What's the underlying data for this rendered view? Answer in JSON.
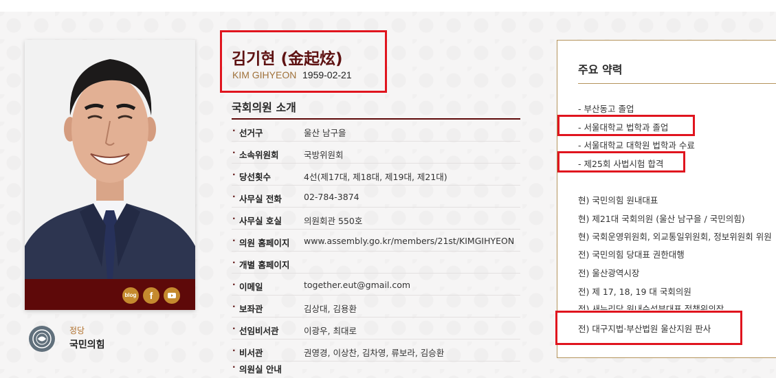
{
  "profile": {
    "name_korean": "김기현 (金起炫)",
    "name_english": "KIM GIHYEON",
    "birth_date": "1959-02-21",
    "party_label": "정당",
    "party_name": "국민의힘",
    "social": [
      "blog",
      "f",
      "youtube"
    ]
  },
  "intro": {
    "title": "국회의원 소개",
    "rows": [
      {
        "label": "선거구",
        "value": "울산 남구을"
      },
      {
        "label": "소속위원회",
        "value": "국방위원회"
      },
      {
        "label": "당선횟수",
        "value": "4선(제17대, 제18대, 제19대, 제21대)"
      },
      {
        "label": "사무실 전화",
        "value": "02-784-3874"
      },
      {
        "label": "사무실 호실",
        "value": "의원회관 550호"
      },
      {
        "label": "의원 홈페이지",
        "value": "www.assembly.go.kr/members/21st/KIMGIHYEON"
      },
      {
        "label": "개별 홈페이지",
        "value": ""
      },
      {
        "label": "이메일",
        "value": "together.eut@gmail.com"
      },
      {
        "label": "보좌관",
        "value": "김상대, 김용환"
      },
      {
        "label": "선임비서관",
        "value": "이광우, 최대로"
      },
      {
        "label": "비서관",
        "value": "권영경, 이상찬, 김차영, 류보라, 김승환"
      },
      {
        "label": "의원실 안내",
        "value": ""
      }
    ]
  },
  "career": {
    "title": "주요 약력",
    "education": [
      "- 부산동고 졸업",
      "- 서울대학교 법학과 졸업",
      "- 서울대학교 대학원 법학과 수료",
      "- 제25회 사법시험 합격"
    ],
    "positions": [
      "현) 국민의힘 원내대표",
      "현) 제21대 국회의원 (울산 남구을 / 국민의힘)",
      "현) 국회운영위원회, 외교통일위원회, 정보위원회 위원",
      "전) 국민의힘 당대표 권한대행",
      "전) 울산광역시장",
      "전) 제 17, 18, 19 대 국회의원",
      "전) 새누리당 원내수석부대표,정책위의장",
      "전) 대구지법·부산법원 울산지원 판사"
    ]
  },
  "colors": {
    "brand_dark_red": "#5e0909",
    "accent_gold": "#b4935b",
    "highlight_red": "#e0141e"
  }
}
